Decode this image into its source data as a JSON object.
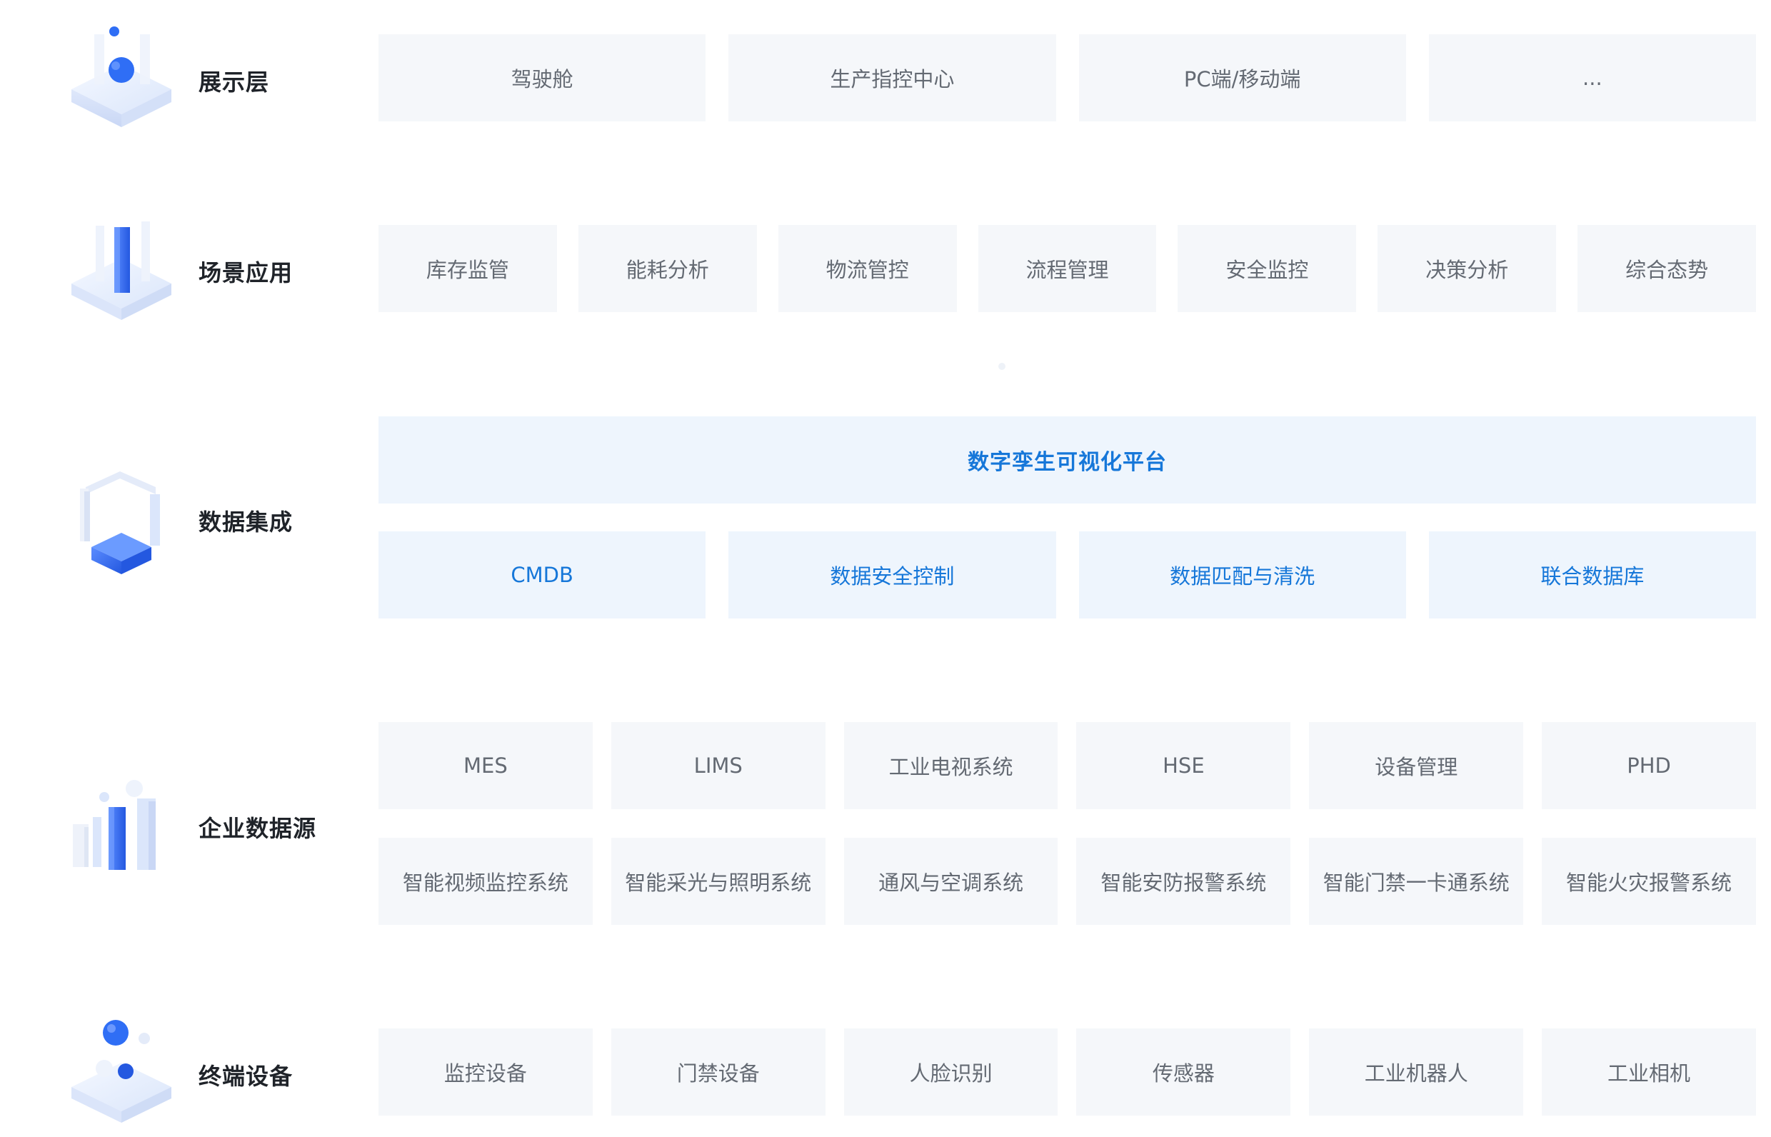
{
  "layers": [
    {
      "title": "展示层",
      "icon": "cube-sphere-icon",
      "rows": [
        [
          "驾驶舱",
          "生产指控中心",
          "PC端/移动端",
          "..."
        ]
      ]
    },
    {
      "title": "场景应用",
      "icon": "cube-pillar-icon",
      "rows": [
        [
          "库存监管",
          "能耗分析",
          "物流管控",
          "流程管理",
          "安全监控",
          "决策分析",
          "综合态势"
        ]
      ]
    },
    {
      "title": "数据集成",
      "icon": "frame-cube-icon",
      "platform": "数字孪生可视化平台",
      "rows": [
        [
          "CMDB",
          "数据安全控制",
          "数据匹配与清洗",
          "联合数据库"
        ]
      ]
    },
    {
      "title": "企业数据源",
      "icon": "bar-columns-icon",
      "rows": [
        [
          "MES",
          "LIMS",
          "工业电视系统",
          "HSE",
          "设备管理",
          "PHD"
        ],
        [
          "智能视频监控系统",
          "智能采光与照明系统",
          "通风与空调系统",
          "智能安防报警系统",
          "智能门禁一卡通系统",
          "智能火灾报警系统"
        ]
      ]
    },
    {
      "title": "终端设备",
      "icon": "cube-bubbles-icon",
      "rows": [
        [
          "监控设备",
          "门禁设备",
          "人脸识别",
          "传感器",
          "工业机器人",
          "工业相机"
        ]
      ]
    }
  ],
  "colors": {
    "box_gray": "#f5f7fa",
    "box_blue": "#eef5fd",
    "text_gray": "#646a73",
    "text_blue": "#1677d9",
    "title": "#1f2329",
    "accent": "#2f6ef5"
  }
}
